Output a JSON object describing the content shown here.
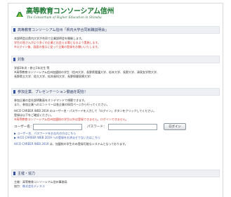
{
  "header": {
    "title": "高等教育コンソーシアム信州",
    "subtitle": "The Consortium of Higher Education in Shinshu"
  },
  "sections": {
    "notice": {
      "heading": "高等教育コンソーシアム信州「県内大学合同就職説明会」",
      "lines": [
        "本説明会は県内大学が合同で企業説明会を開催します。",
        "学生の皆さんがより多くの企業と出会える場となるよう実施します。",
        "※ログイン後、画面の指示に従って企業の登録をお願いいたします。"
      ]
    },
    "target": {
      "heading": "対象",
      "lines": [
        "学部3年次・修士1年次生 等",
        "※高等教育コンソーシアム信州加盟校の学生（信州大学、長野県看護大学、松本大学、長野大学、清泉女学院大学、",
        "長野県立大学、佐久大学、松本歯科大学、長野保健医療大学）"
      ]
    },
    "login": {
      "heading": "参加企業、プレゼンテーション動画を配信！",
      "lines": [
        "参加企業の会社説明動画をオンデマンドで視聴できます。",
        "また、参加企業へのエントリーは各企業の採用ページから行ってください。",
        "HiCO CAREER WEB 2019 のユーザー名・パスワードを入力して「ログイン」ボタンをクリックしてください。",
        "登録は以下をご確認ください。"
      ],
      "note": "※高等教育コンソーシアム信州加盟校の学生以外は登録できません。ログインできません。",
      "username_label": "ユーザー名：",
      "password_label": "パスワード：",
      "username_value": "",
      "password_value": "",
      "login_button": "ログイン",
      "links": [
        "ユーザー名、パスワードをお忘れの方はこちら",
        "HiCO CAREER WEB 2019 への登録をお済ませでない方はこちら"
      ],
      "footer_link": "HiCO CAREER WEB 2019",
      "footer_text": " は、加盟校の学生のみ登録可能なシステムとなっております。"
    },
    "organizer": {
      "heading": "主催・協力",
      "lines": [
        "主催：高等教育コンソーシアム信州事務局",
        "協力：株式会社ディスコ"
      ],
      "link_text": "株式会社ディスコ"
    }
  },
  "colors": {
    "logo_green": "#1f7a35",
    "heading_bar": "#3a55a0",
    "alert_red": "#d4362f",
    "link_blue": "#3f5fb0"
  }
}
